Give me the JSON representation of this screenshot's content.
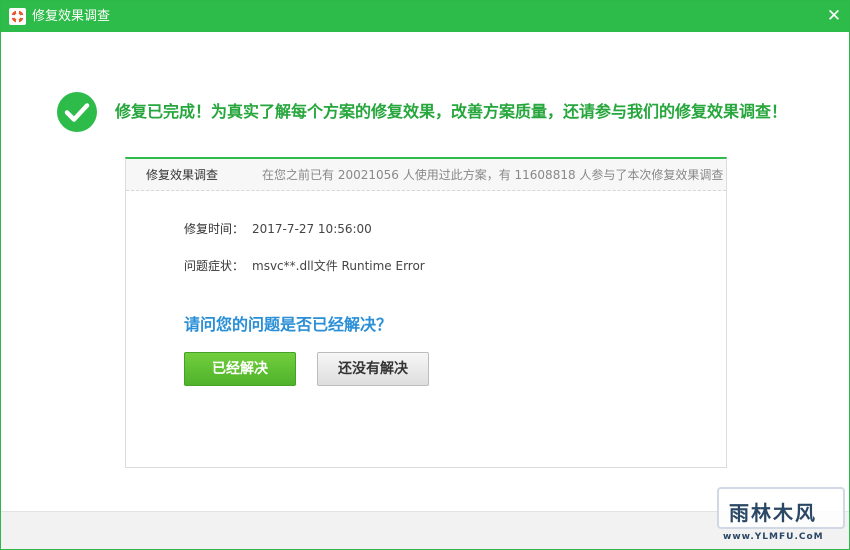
{
  "window": {
    "title": "修复效果调查",
    "close_glyph": "✕",
    "accent_color": "#2dbb4a"
  },
  "result": {
    "message": "修复已完成！为真实了解每个方案的修复效果，改善方案质量，还请参与我们的修复效果调查！",
    "icon": "check-circle-icon"
  },
  "survey": {
    "title": "修复效果调查",
    "stats": "在您之前已有 20021056 人使用过此方案，有 11608818 人参与了本次修复效果调查",
    "fields": [
      {
        "label": "修复时间：",
        "value": "2017-7-27 10:56:00"
      },
      {
        "label": "问题症状：",
        "value": "msvc**.dll文件 Runtime Error"
      }
    ],
    "question": "请问您的问题是否已经解决？",
    "resolved_label": "已经解决",
    "unresolved_label": "还没有解决"
  },
  "watermark": {
    "text": "雨林木风",
    "url": "www.YLMFU.CoM"
  }
}
